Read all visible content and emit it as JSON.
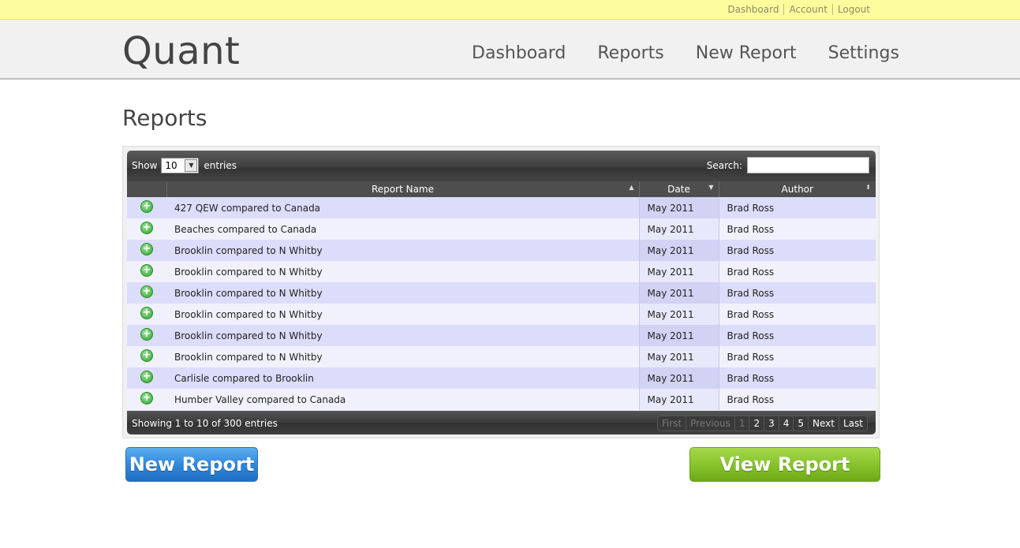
{
  "topbar": {
    "links": [
      "Dashboard",
      "Account",
      "Logout"
    ]
  },
  "header": {
    "logo": "Quant",
    "nav": [
      "Dashboard",
      "Reports",
      "New Report",
      "Settings"
    ]
  },
  "page": {
    "title": "Reports"
  },
  "table_controls": {
    "show_label": "Show",
    "entries_label": "entries",
    "page_size": "10",
    "search_label": "Search:",
    "search_value": ""
  },
  "table": {
    "columns": [
      "",
      "Report Name",
      "Date",
      "Author"
    ],
    "sorted_column": "Date",
    "rows": [
      {
        "name": "427 QEW compared to Canada",
        "date": "May 2011",
        "author": "Brad Ross"
      },
      {
        "name": "Beaches compared to Canada",
        "date": "May 2011",
        "author": "Brad Ross"
      },
      {
        "name": "Brooklin compared to N Whitby",
        "date": "May 2011",
        "author": "Brad Ross"
      },
      {
        "name": "Brooklin compared to N Whitby",
        "date": "May 2011",
        "author": "Brad Ross"
      },
      {
        "name": "Brooklin compared to N Whitby",
        "date": "May 2011",
        "author": "Brad Ross"
      },
      {
        "name": "Brooklin compared to N Whitby",
        "date": "May 2011",
        "author": "Brad Ross"
      },
      {
        "name": "Brooklin compared to N Whitby",
        "date": "May 2011",
        "author": "Brad Ross"
      },
      {
        "name": "Brooklin compared to N Whitby",
        "date": "May 2011",
        "author": "Brad Ross"
      },
      {
        "name": "Carlisle compared to Brooklin",
        "date": "May 2011",
        "author": "Brad Ross"
      },
      {
        "name": "Humber Valley compared to Canada",
        "date": "May 2011",
        "author": "Brad Ross"
      }
    ],
    "row_icon": "plus-circle-icon"
  },
  "footer": {
    "info": "Showing 1 to 10 of 300 entries",
    "pager": [
      "First",
      "Previous",
      "1",
      "2",
      "3",
      "4",
      "5",
      "Next",
      "Last"
    ],
    "current_page": "1"
  },
  "buttons": {
    "new_report": "New Report",
    "view_report": "View Report"
  },
  "colors": {
    "topbar": "#fdfd9d",
    "row_odd": "#dcdcfb",
    "row_even": "#f1f1fd",
    "blue_button": "#2e86d9",
    "green_button": "#84c22a",
    "expand_icon": "#2aa62a"
  }
}
